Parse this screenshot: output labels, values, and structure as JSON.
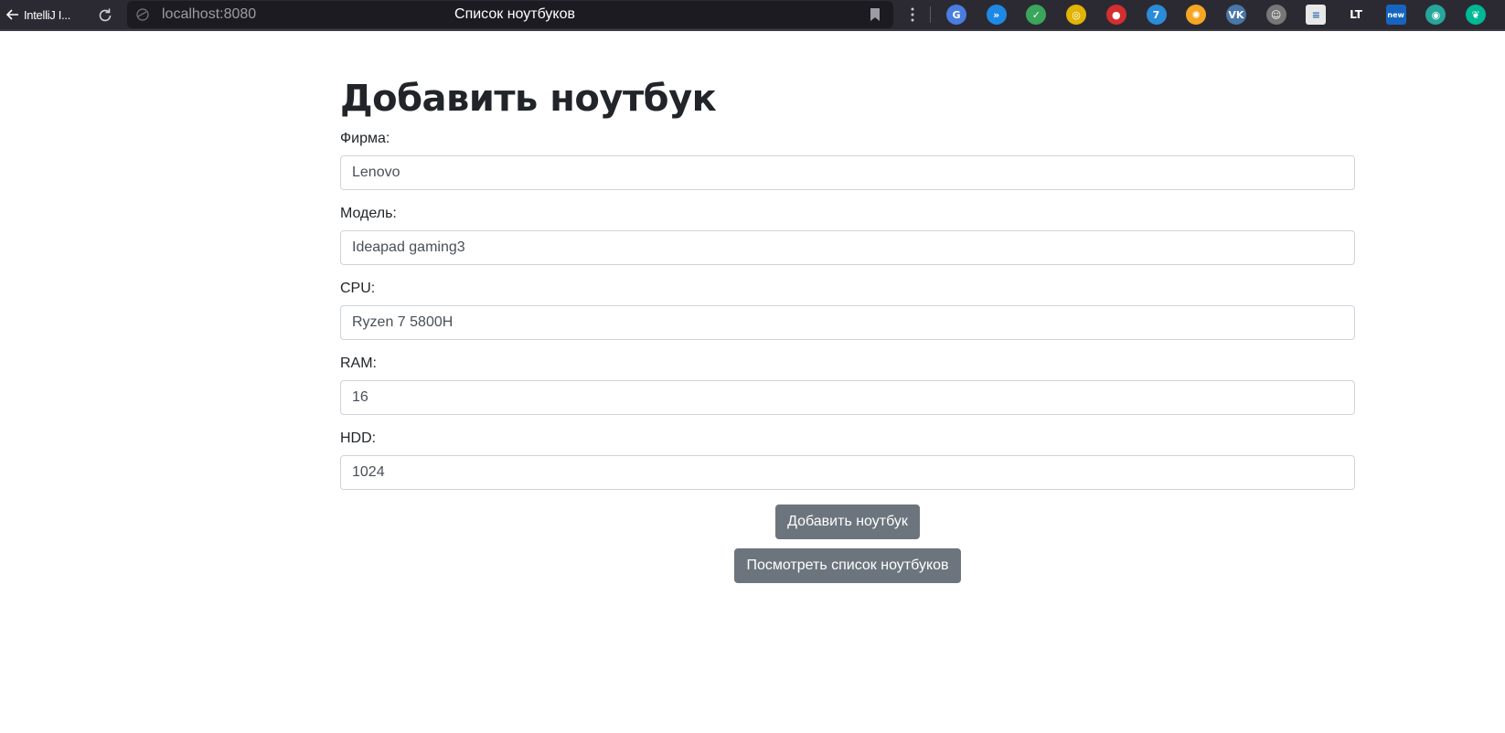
{
  "browser": {
    "back_label": "IntelliJ I...",
    "url": "localhost:8080",
    "tab_title": "Список ноутбуков",
    "extensions": [
      {
        "name": "google-translate-icon",
        "color": "#4a7de0",
        "glyph": "G"
      },
      {
        "name": "extension-blue-circle-icon",
        "color": "#1e88e5",
        "glyph": "»"
      },
      {
        "name": "shield-check-icon",
        "color": "#3ba55c",
        "glyph": "✓"
      },
      {
        "name": "extension-yellow-ring-icon",
        "color": "#e0b400",
        "glyph": "◎"
      },
      {
        "name": "extension-red-icon",
        "color": "#d32f2f",
        "glyph": "●"
      },
      {
        "name": "extension-blue-7-icon",
        "color": "#2a8bd8",
        "glyph": "7"
      },
      {
        "name": "orange-icon",
        "color": "#f5a623",
        "glyph": "✺"
      },
      {
        "name": "vk-icon",
        "color": "#4a76a8",
        "glyph": "VK"
      },
      {
        "name": "extension-gray-icon",
        "color": "#777777",
        "glyph": "☺"
      },
      {
        "name": "extension-doc-icon",
        "color": "#e8e8e8",
        "glyph": "≡"
      },
      {
        "name": "extension-lt-icon",
        "color": "#2b2a33",
        "glyph": "LT"
      },
      {
        "name": "extension-new-icon",
        "color": "#1565c0",
        "glyph": "new"
      },
      {
        "name": "extension-green-icon",
        "color": "#26a69a",
        "glyph": "◉"
      },
      {
        "name": "extension-teal-bird-icon",
        "color": "#00b894",
        "glyph": "❦"
      }
    ]
  },
  "page": {
    "heading": "Добавить ноутбук",
    "fields": [
      {
        "label": "Фирма:",
        "value": "Lenovo"
      },
      {
        "label": "Модель:",
        "value": "Ideapad gaming3"
      },
      {
        "label": "CPU:",
        "value": "Ryzen 7 5800H"
      },
      {
        "label": "RAM:",
        "value": "16"
      },
      {
        "label": "HDD:",
        "value": "1024"
      }
    ],
    "submit_label": "Добавить ноутбук",
    "view_list_label": "Посмотреть список ноутбуков"
  },
  "colors": {
    "topbar": "#2b2a33",
    "button": "#6c757d"
  }
}
